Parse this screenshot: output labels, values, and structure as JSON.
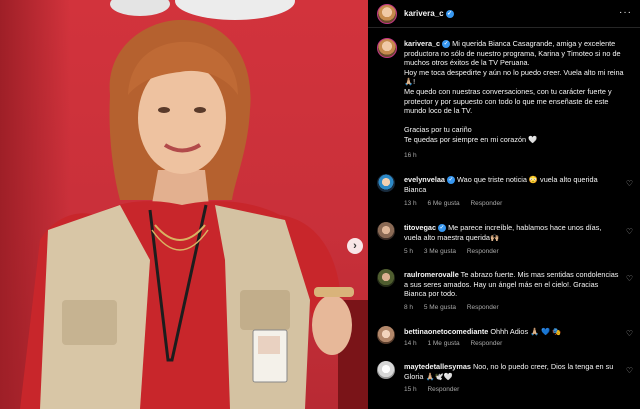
{
  "post": {
    "username": "karivera_c",
    "caption_lines": [
      "Mi querida Bianca Casagrande, amiga y excelente productora no sólo de nuestro programa, Karina y Timoteo si no de muchos otros éxitos de la TV Peruana.",
      "Hoy me toca despedirte y aún no lo puedo creer. Vuela alto mi reina🙏🏼!",
      "Me quedo con nuestras conversaciones, con tu carácter fuerte y protector y por supuesto con todo lo que me enseñaste de este mundo loco de la TV.",
      "",
      "Gracias por tu cariño",
      "Te quedas por siempre en mi corazón 🤍"
    ],
    "time": "16 h"
  },
  "carousel_next": "›",
  "more_glyph": "···",
  "verified_glyph": "✓",
  "heart_glyph": "♡",
  "comments": [
    {
      "username": "evelynvelaa",
      "verified": true,
      "text": "Wao que triste noticia 😳 vuela alto querida Bianca",
      "time": "13 h",
      "likes": "6 Me gusta",
      "reply": "Responder"
    },
    {
      "username": "titovegac",
      "verified": true,
      "text": "Me parece increíble, hablamos hace unos días, vuela alto maestra querida🙌🏼",
      "time": "5 h",
      "likes": "3 Me gusta",
      "reply": "Responder"
    },
    {
      "username": "raulromerovalle",
      "verified": false,
      "text": "Te abrazo fuerte. Mis mas sentidas condolencias a sus seres amados. Hay un ángel más en el cielo!. Gracias Bianca por todo.",
      "time": "8 h",
      "likes": "5 Me gusta",
      "reply": "Responder"
    },
    {
      "username": "bettinaonetocomediante",
      "verified": false,
      "text": "Ohhh Adios 🙏🏼 💙 🎭",
      "time": "14 h",
      "likes": "1 Me gusta",
      "reply": "Responder"
    },
    {
      "username": "maytedetallesymas",
      "verified": false,
      "text": "Noo, no lo puedo creer, Dios la tenga en su Gloria 🙏🏼🕊️🤍",
      "time": "15 h",
      "likes": "",
      "reply": "Responder"
    }
  ]
}
